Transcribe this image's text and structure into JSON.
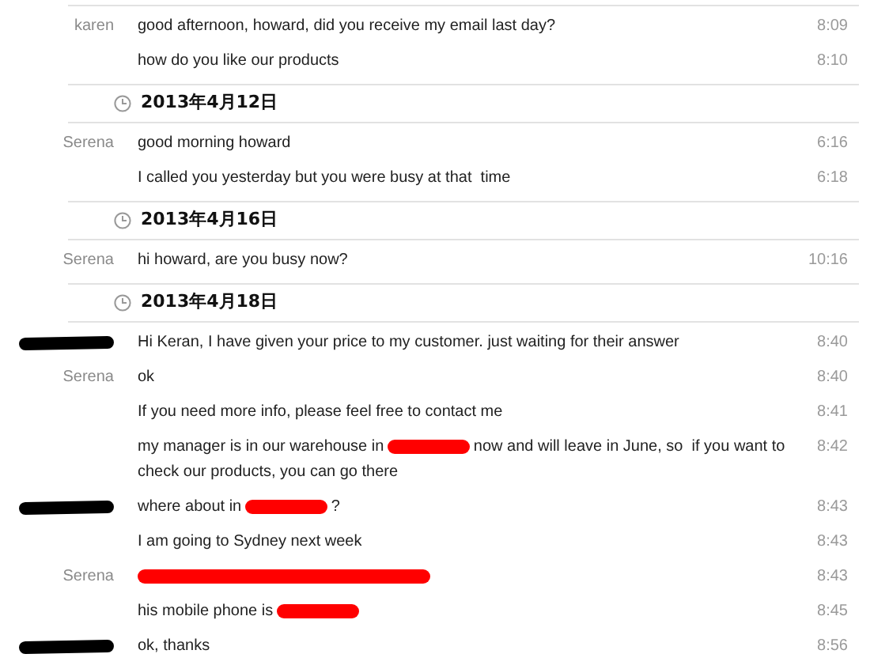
{
  "entries": [
    {
      "kind": "message",
      "sender": "karen",
      "parts": [
        {
          "kind": "text",
          "text": "good afternoon, howard, did you receive my email last day?"
        }
      ],
      "time": "8:09"
    },
    {
      "kind": "message",
      "parts": [
        {
          "kind": "text",
          "text": "how do you like our products"
        }
      ],
      "time": "8:10"
    },
    {
      "kind": "date",
      "text": "2013年4月12日"
    },
    {
      "kind": "message",
      "sender": "Serena",
      "parts": [
        {
          "kind": "text",
          "text": "good morning howard"
        }
      ],
      "time": "6:16"
    },
    {
      "kind": "message",
      "parts": [
        {
          "kind": "text",
          "text": "I called you yesterday but you were busy at that  time"
        }
      ],
      "time": "6:18"
    },
    {
      "kind": "date",
      "text": "2013年4月16日"
    },
    {
      "kind": "message",
      "sender": "Serena",
      "parts": [
        {
          "kind": "text",
          "text": "hi howard, are you busy now?"
        }
      ],
      "time": "10:16"
    },
    {
      "kind": "date",
      "text": "2013年4月18日"
    },
    {
      "kind": "message",
      "sender_redacted": true,
      "parts": [
        {
          "kind": "text",
          "text": "Hi Keran, I have given your price to my customer. just waiting for their answer"
        }
      ],
      "time": "8:40"
    },
    {
      "kind": "message",
      "sender": "Serena",
      "parts": [
        {
          "kind": "text",
          "text": "ok"
        }
      ],
      "time": "8:40"
    },
    {
      "kind": "message",
      "parts": [
        {
          "kind": "text",
          "text": "If you need more info, please feel free to contact me"
        }
      ],
      "time": "8:41"
    },
    {
      "kind": "message",
      "parts": [
        {
          "kind": "text",
          "text": "my manager is in our warehouse in"
        },
        {
          "kind": "redaction"
        },
        {
          "kind": "text",
          "text": "now and will leave in June, so  if you want to check our products, you can go there"
        }
      ],
      "time": "8:42"
    },
    {
      "kind": "message",
      "sender_redacted": true,
      "parts": [
        {
          "kind": "text",
          "text": "where about in"
        },
        {
          "kind": "redaction"
        },
        {
          "kind": "text",
          "text": "?"
        }
      ],
      "time": "8:43"
    },
    {
      "kind": "message",
      "parts": [
        {
          "kind": "text",
          "text": "I am going to Sydney next week"
        }
      ],
      "time": "8:43"
    },
    {
      "kind": "message",
      "sender": "Serena",
      "parts": [
        {
          "kind": "redaction"
        }
      ],
      "time": "8:43"
    },
    {
      "kind": "message",
      "parts": [
        {
          "kind": "text",
          "text": "his mobile phone is"
        },
        {
          "kind": "redaction"
        }
      ],
      "time": "8:45"
    },
    {
      "kind": "message",
      "sender_redacted": true,
      "parts": [
        {
          "kind": "text",
          "text": "ok, thanks"
        }
      ],
      "time": "8:56"
    }
  ]
}
